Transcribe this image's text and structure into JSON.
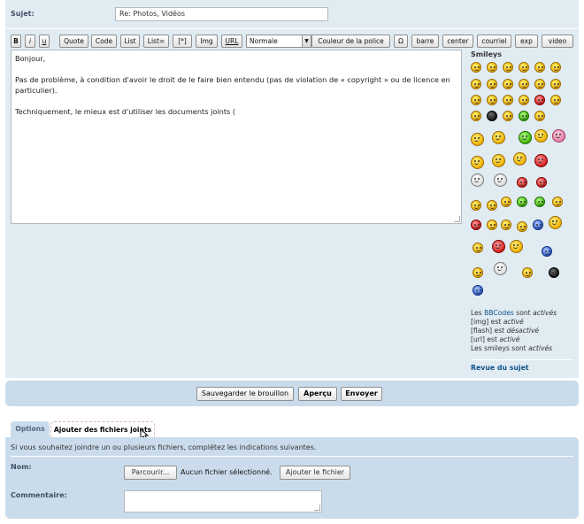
{
  "subject": {
    "label": "Sujet:",
    "value": "Re: Photos, Vidéos"
  },
  "toolbar": {
    "bold": "B",
    "italic": "i",
    "underline": "u",
    "quote": "Quote",
    "code": "Code",
    "list": "List",
    "list_eq": "List=",
    "list_item": "[*]",
    "img": "Img",
    "url": "URL",
    "size_select": "Normale",
    "font_color": "Couleur de la police",
    "omega": "Ω",
    "barre": "barre",
    "center": "center",
    "courriel": "courriel",
    "exp": "exp",
    "video": "video"
  },
  "editor": {
    "lines": [
      "Bonjour,",
      "Pas de problème, à condition d'avoir le droit de le faire bien entendu (pas de violation de « copyright » ou de licence en particulier).",
      "Techniquement, le mieux est d'utiliser les documents joints ("
    ]
  },
  "smileys": {
    "title": "Smileys",
    "colors": {
      "yellow": "#f0b000",
      "red": "#d82020",
      "green": "#3cb800",
      "blue": "#2a5bd0"
    }
  },
  "info": {
    "bbcode_prefix": "Les ",
    "bbcode_link": "BBCodes",
    "bbcode_mid": " sont ",
    "bbcode_state": "activés",
    "img_prefix": "[img] est ",
    "img_state": "activé",
    "flash_prefix": "[flash] est ",
    "flash_state": "désactivé",
    "url_prefix": "[url] est ",
    "url_state": "activé",
    "smileys_prefix": "Les smileys sont ",
    "smileys_state": "activés",
    "review_link": "Revue du sujet"
  },
  "actions": {
    "save_draft": "Sauvegarder le brouillon",
    "preview": "Aperçu",
    "submit": "Envoyer"
  },
  "tabs": {
    "options": "Options",
    "attachments": "Ajouter des fichiers joints"
  },
  "attachments": {
    "intro": "Si vous souhaitez joindre un ou plusieurs fichiers, complétez les indications suivantes.",
    "name_label": "Nom:",
    "browse": "Parcourir...",
    "no_file": "Aucun fichier sélectionné.",
    "add_file": "Ajouter le fichier",
    "comment_label": "Commentaire:"
  },
  "colors": {
    "panel_light": "#e1ebf2",
    "panel_dark": "#cadceb",
    "link": "#105289",
    "label": "#425067"
  }
}
